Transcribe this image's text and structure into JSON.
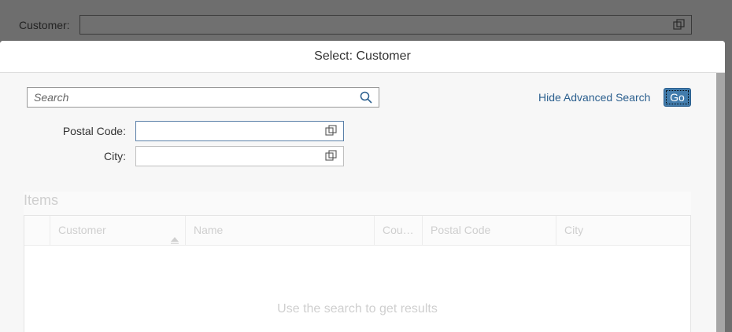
{
  "background_form": {
    "customer_label": "Customer:"
  },
  "dialog": {
    "title": "Select: Customer",
    "search": {
      "placeholder": "Search",
      "value": ""
    },
    "advanced_link": "Hide Advanced Search",
    "go_button": "Go",
    "fields": [
      {
        "label": "Postal Code:",
        "value": ""
      },
      {
        "label": "City:",
        "value": ""
      }
    ],
    "items_title": "Items",
    "table": {
      "columns": [
        "Customer",
        "Name",
        "Cou…",
        "Postal Code",
        "City"
      ],
      "no_data_text": "Use the search to get results"
    }
  },
  "colors": {
    "overlay": "#6e6e6e",
    "accent": "#427cac",
    "link": "#2b5f8e"
  }
}
